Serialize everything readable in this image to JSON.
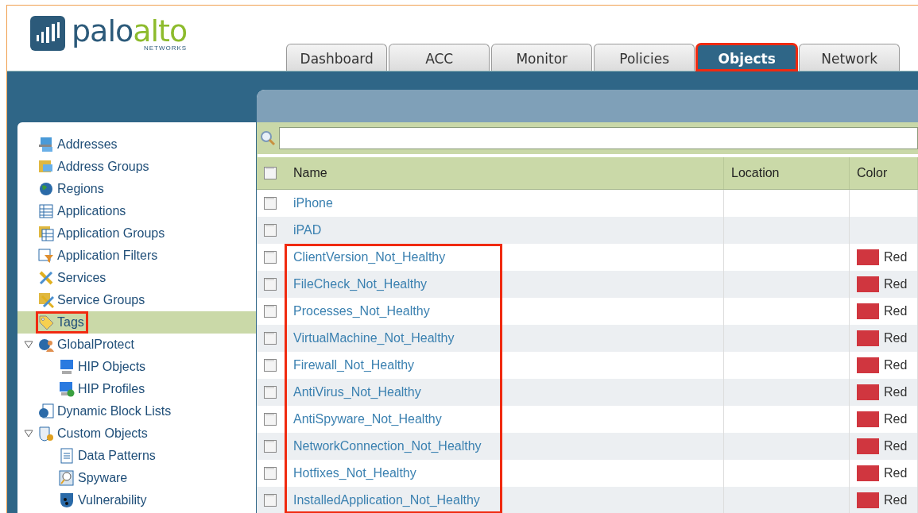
{
  "logo": {
    "primary": "palo",
    "secondary": "alto",
    "tagline": "NETWORKS"
  },
  "tabs": [
    {
      "label": "Dashboard",
      "selected": false,
      "highlighted": false
    },
    {
      "label": "ACC",
      "selected": false,
      "highlighted": false
    },
    {
      "label": "Monitor",
      "selected": false,
      "highlighted": false
    },
    {
      "label": "Policies",
      "selected": false,
      "highlighted": false
    },
    {
      "label": "Objects",
      "selected": true,
      "highlighted": true
    },
    {
      "label": "Network",
      "selected": false,
      "highlighted": false
    }
  ],
  "sidebar": {
    "items": [
      {
        "label": "Addresses",
        "selected": false
      },
      {
        "label": "Address Groups",
        "selected": false
      },
      {
        "label": "Regions",
        "selected": false
      },
      {
        "label": "Applications",
        "selected": false
      },
      {
        "label": "Application Groups",
        "selected": false
      },
      {
        "label": "Application Filters",
        "selected": false
      },
      {
        "label": "Services",
        "selected": false
      },
      {
        "label": "Service Groups",
        "selected": false
      },
      {
        "label": "Tags",
        "selected": true,
        "highlighted": true
      },
      {
        "label": "GlobalProtect",
        "selected": false,
        "expanded": true,
        "children": [
          {
            "label": "HIP Objects",
            "selected": false
          },
          {
            "label": "HIP Profiles",
            "selected": false
          }
        ]
      },
      {
        "label": "Dynamic Block Lists",
        "selected": false
      },
      {
        "label": "Custom Objects",
        "selected": false,
        "expanded": true,
        "children": [
          {
            "label": "Data Patterns",
            "selected": false
          },
          {
            "label": "Spyware",
            "selected": false
          },
          {
            "label": "Vulnerability",
            "selected": false
          }
        ]
      }
    ]
  },
  "table": {
    "select_all": {
      "checked": false
    },
    "columns": [
      "Name",
      "Location",
      "Color"
    ],
    "rows": [
      {
        "name": "iPhone",
        "checked": false,
        "highlighted": false
      },
      {
        "name": "iPAD",
        "checked": false,
        "highlighted": false
      },
      {
        "name": "ClientVersion_Not_Healthy",
        "color_name": "Red",
        "color": "#d0363f",
        "checked": false,
        "highlighted": true
      },
      {
        "name": "FileCheck_Not_Healthy",
        "color_name": "Red",
        "color": "#d0363f",
        "checked": false,
        "highlighted": true
      },
      {
        "name": "Processes_Not_Healthy",
        "color_name": "Red",
        "color": "#d0363f",
        "checked": false,
        "highlighted": true
      },
      {
        "name": "VirtualMachine_Not_Healthy",
        "color_name": "Red",
        "color": "#d0363f",
        "checked": false,
        "highlighted": true
      },
      {
        "name": "Firewall_Not_Healthy",
        "color_name": "Red",
        "color": "#d0363f",
        "checked": false,
        "highlighted": true
      },
      {
        "name": "AntiVirus_Not_Healthy",
        "color_name": "Red",
        "color": "#d0363f",
        "checked": false,
        "highlighted": true
      },
      {
        "name": "AntiSpyware_Not_Healthy",
        "color_name": "Red",
        "color": "#d0363f",
        "checked": false,
        "highlighted": true
      },
      {
        "name": "NetworkConnection_Not_Healthy",
        "color_name": "Red",
        "color": "#d0363f",
        "checked": false,
        "highlighted": true
      },
      {
        "name": "Hotfixes_Not_Healthy",
        "color_name": "Red",
        "color": "#d0363f",
        "checked": false,
        "highlighted": true
      },
      {
        "name": "InstalledApplication_Not_Healthy",
        "color_name": "Red",
        "color": "#d0363f",
        "checked": false,
        "highlighted": true
      }
    ]
  }
}
